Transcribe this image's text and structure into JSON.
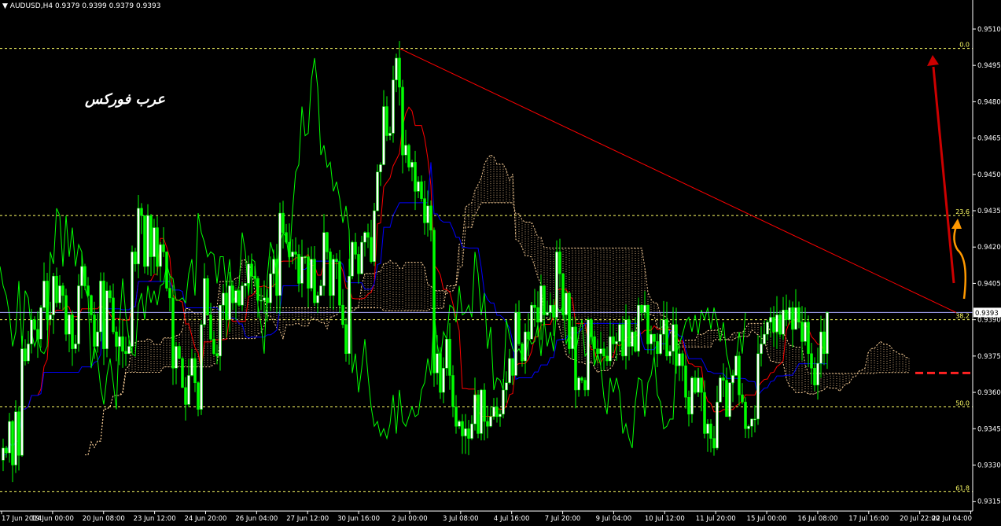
{
  "header": {
    "symbol_timeframe": "AUDUSD,H4",
    "ohlc": "0.9379 0.9399 0.9379 0.9393"
  },
  "watermark": "عرب فوركس",
  "colors": {
    "background": "#000000",
    "bull_candle": "#ffffff",
    "bear_candle": "#00ff00",
    "tenkan": "#ff0000",
    "kijun": "#0000ff",
    "chikou": "#00ff00",
    "cloud": "#ffd39b",
    "fib": "#ffff66",
    "trendline": "#ff0000",
    "up_arrow": "#cc0000",
    "curve_arrow": "#ff9900",
    "support_dash": "#ff2222",
    "price_line": "#aaaaff"
  },
  "chart_data": {
    "type": "candlestick",
    "ylim": [
      0.9311,
      0.9522
    ],
    "price_axis": {
      "ticks": [
        "0.9510",
        "0.9495",
        "0.9480",
        "0.9465",
        "0.9450",
        "0.9435",
        "0.9420",
        "0.9405",
        "0.9390",
        "0.9375",
        "0.9360",
        "0.9345",
        "0.9330",
        "0.9315"
      ],
      "current_price": "0.9393"
    },
    "time_axis": {
      "labels": [
        "17 Jun 2014",
        "19 Jun 00:00",
        "20 Jun 08:00",
        "23 Jun 12:00",
        "24 Jun 20:00",
        "26 Jun 04:00",
        "27 Jun 12:00",
        "30 Jun 16:00",
        "2 Jul 00:00",
        "3 Jul 08:00",
        "4 Jul 16:00",
        "7 Jul 20:00",
        "9 Jul 04:00",
        "10 Jul 12:00",
        "11 Jul 20:00",
        "15 Jul 00:00",
        "16 Jul 08:00",
        "17 Jul 16:00",
        "20 Jul 22:00",
        "22 Jul 04:00"
      ]
    },
    "fibonacci": [
      {
        "label": "0.0",
        "price": 0.9502
      },
      {
        "label": "23.6",
        "price": 0.9433
      },
      {
        "label": "38.2",
        "price": 0.939
      },
      {
        "label": "50.0",
        "price": 0.9354
      },
      {
        "label": "61.8",
        "price": 0.9319
      }
    ],
    "trendline": {
      "from": {
        "bar": 126,
        "price": 0.9502
      },
      "to": {
        "bar": 303,
        "price": 0.9393
      }
    },
    "support_line_price": 0.9368,
    "closes": [
      0.9337,
      0.9335,
      0.9348,
      0.933,
      0.9352,
      0.9334,
      0.9378,
      0.9373,
      0.938,
      0.939,
      0.9386,
      0.9382,
      0.9395,
      0.9406,
      0.939,
      0.9392,
      0.9408,
      0.9397,
      0.9404,
      0.94,
      0.9384,
      0.9392,
      0.9378,
      0.938,
      0.9404,
      0.9412,
      0.9404,
      0.94,
      0.9392,
      0.9379,
      0.9385,
      0.9406,
      0.9378,
      0.9402,
      0.9399,
      0.9385,
      0.9379,
      0.9383,
      0.9377,
      0.9376,
      0.9379,
      0.9418,
      0.9413,
      0.9436,
      0.9433,
      0.9412,
      0.9433,
      0.9416,
      0.9428,
      0.9412,
      0.9421,
      0.9418,
      0.9403,
      0.9399,
      0.937,
      0.9379,
      0.9374,
      0.9362,
      0.9355,
      0.9367,
      0.9374,
      0.9364,
      0.9353,
      0.9388,
      0.9407,
      0.9392,
      0.9382,
      0.9376,
      0.9375,
      0.9396,
      0.9401,
      0.939,
      0.9404,
      0.9397,
      0.9402,
      0.9396,
      0.9404,
      0.9405,
      0.9413,
      0.9408,
      0.9407,
      0.9398,
      0.9398,
      0.9399,
      0.9397,
      0.9409,
      0.9415,
      0.94,
      0.9434,
      0.9426,
      0.9422,
      0.9416,
      0.9418,
      0.9417,
      0.9405,
      0.9416,
      0.9416,
      0.9403,
      0.9415,
      0.9397,
      0.94,
      0.9404,
      0.9426,
      0.9418,
      0.94,
      0.9415,
      0.9414,
      0.9396,
      0.9388,
      0.9376,
      0.9408,
      0.9422,
      0.9417,
      0.9409,
      0.9422,
      0.9426,
      0.9424,
      0.9414,
      0.9435,
      0.9451,
      0.9454,
      0.9478,
      0.9466,
      0.9467,
      0.9489,
      0.9498,
      0.9486,
      0.9458,
      0.9462,
      0.9453,
      0.9455,
      0.9443,
      0.9447,
      0.944,
      0.943,
      0.9437,
      0.9427,
      0.9368,
      0.9376,
      0.936,
      0.937,
      0.9382,
      0.9367,
      0.9354,
      0.9346,
      0.9348,
      0.9342,
      0.9345,
      0.9341,
      0.9347,
      0.9359,
      0.9343,
      0.9361,
      0.9348,
      0.9346,
      0.935,
      0.9354,
      0.935,
      0.9351,
      0.9361,
      0.9364,
      0.9374,
      0.9367,
      0.9393,
      0.938,
      0.9373,
      0.9385,
      0.9382,
      0.9396,
      0.9395,
      0.9389,
      0.9404,
      0.9392,
      0.9393,
      0.9396,
      0.9391,
      0.9418,
      0.9409,
      0.9392,
      0.9401,
      0.9378,
      0.9387,
      0.9361,
      0.9366,
      0.9365,
      0.9361,
      0.939,
      0.9383,
      0.9378,
      0.9376,
      0.9378,
      0.9375,
      0.9373,
      0.9383,
      0.938,
      0.9381,
      0.9388,
      0.9375,
      0.939,
      0.9379,
      0.9385,
      0.9377,
      0.9396,
      0.9393,
      0.9396,
      0.938,
      0.9384,
      0.9381,
      0.9376,
      0.9384,
      0.939,
      0.9375,
      0.9377,
      0.9388,
      0.9371,
      0.9376,
      0.9371,
      0.9358,
      0.9351,
      0.9366,
      0.936,
      0.9366,
      0.936,
      0.9343,
      0.9347,
      0.9341,
      0.9337,
      0.9356,
      0.9366,
      0.9365,
      0.935,
      0.9364,
      0.9367,
      0.9375,
      0.9359,
      0.9356,
      0.9345,
      0.9346,
      0.9349,
      0.9349,
      0.9376,
      0.938,
      0.9384,
      0.9389,
      0.9391,
      0.9385,
      0.9392,
      0.9384,
      0.9394,
      0.939,
      0.9395,
      0.9386,
      0.9395,
      0.9389,
      0.9381,
      0.9389,
      0.9376,
      0.937,
      0.9363,
      0.9372,
      0.9385,
      0.9376,
      0.9393
    ]
  }
}
